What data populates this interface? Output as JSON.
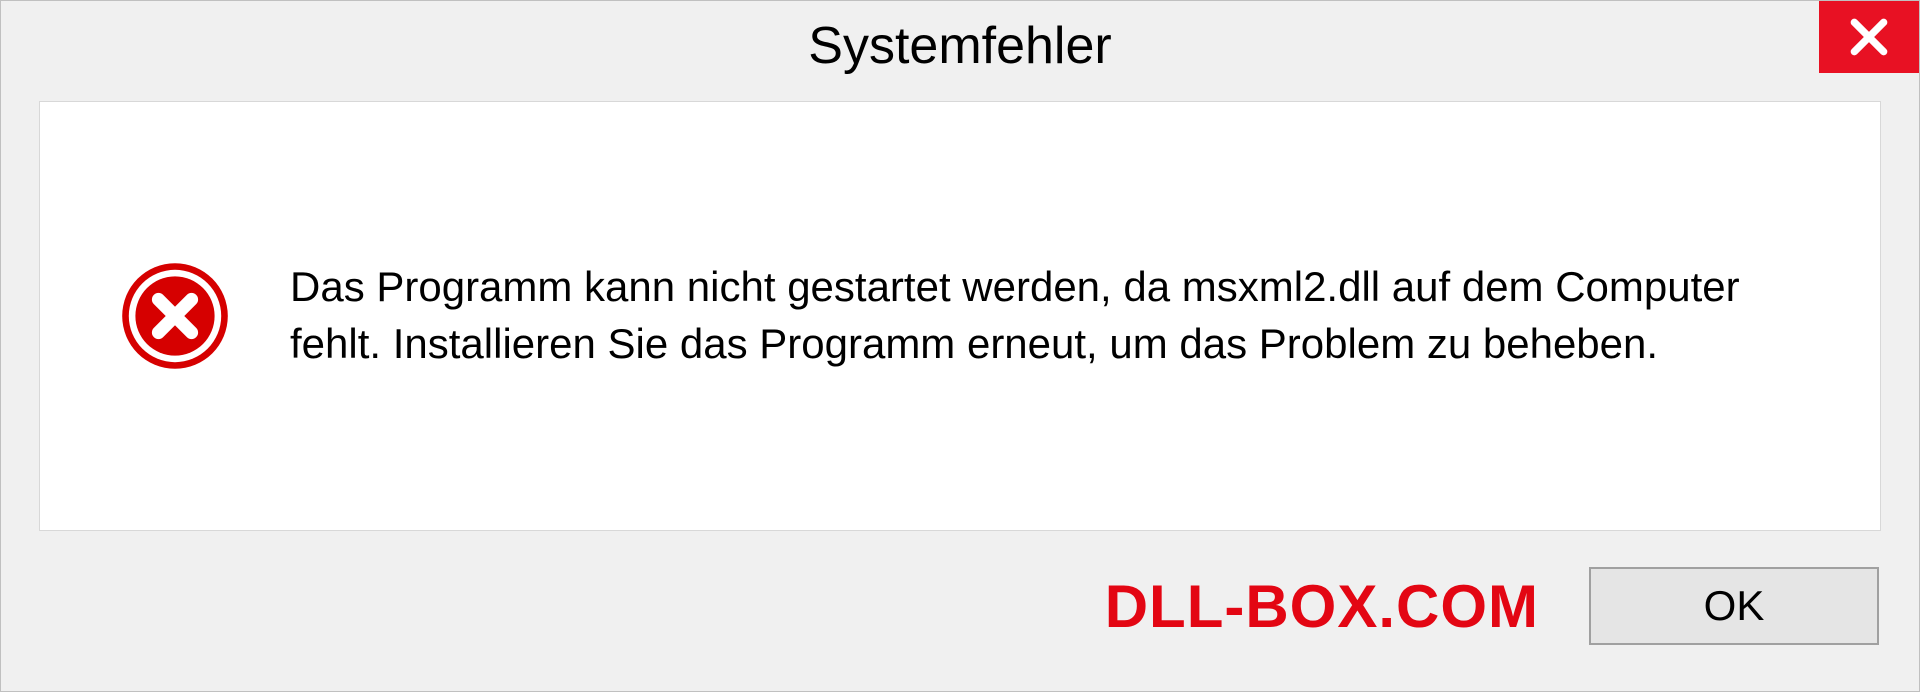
{
  "dialog": {
    "title": "Systemfehler",
    "message": "Das Programm kann nicht gestartet werden, da msxml2.dll auf dem Computer fehlt. Installieren Sie das Programm erneut, um das Problem zu beheben.",
    "ok_label": "OK"
  },
  "watermark": "DLL-BOX.COM"
}
